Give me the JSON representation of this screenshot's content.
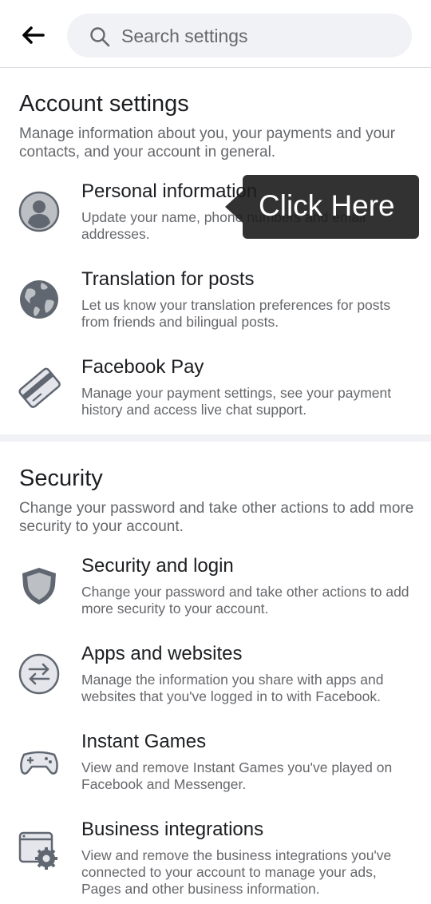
{
  "header": {
    "back_icon": "arrow-left-icon",
    "search_icon": "search-icon",
    "search_placeholder": "Search settings"
  },
  "account": {
    "title": "Account settings",
    "description": "Manage information about you, your payments and your contacts, and your account in general.",
    "items": [
      {
        "icon": "person-icon",
        "title": "Personal information",
        "description": "Update your name, phone numbers and email addresses."
      },
      {
        "icon": "globe-icon",
        "title": "Translation for posts",
        "description": "Let us know your translation preferences for posts from friends and bilingual posts."
      },
      {
        "icon": "credit-card-icon",
        "title": "Facebook Pay",
        "description": "Manage your payment settings, see your payment history and access live chat support."
      }
    ]
  },
  "security": {
    "title": "Security",
    "description": "Change your password and take other actions to add more security to your account.",
    "items": [
      {
        "icon": "shield-icon",
        "title": "Security and login",
        "description": "Change your password and take other actions to add more security to your account."
      },
      {
        "icon": "swap-arrows-icon",
        "title": "Apps and websites",
        "description": "Manage the information you share with apps and websites that you've logged in to with Facebook."
      },
      {
        "icon": "gamepad-icon",
        "title": "Instant Games",
        "description": "View and remove Instant Games you've played on Facebook and Messenger."
      },
      {
        "icon": "browser-gear-icon",
        "title": "Business integrations",
        "description": "View and remove the business integrations you've connected to your account to manage your ads, Pages and other business information."
      }
    ]
  },
  "tooltip": {
    "text": "Click Here"
  },
  "colors": {
    "primary_text": "#1c1e21",
    "secondary_text": "#65676b",
    "search_bg": "#f0f2f5",
    "icon_fill": "#606770",
    "icon_light": "#e4e6eb"
  }
}
